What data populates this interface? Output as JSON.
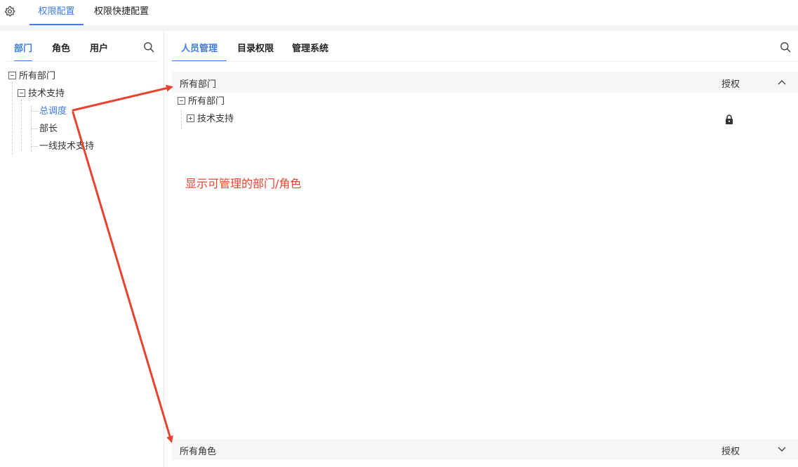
{
  "top_tabs": [
    {
      "label": "权限配置"
    },
    {
      "label": "权限快捷配置"
    }
  ],
  "left": {
    "tabs": [
      {
        "label": "部门"
      },
      {
        "label": "角色"
      },
      {
        "label": "用户"
      }
    ],
    "tree": {
      "root": "所有部门",
      "child": "技术支持",
      "leaves": [
        "总调度",
        "部长",
        "一线技术支持"
      ]
    }
  },
  "right": {
    "tabs": [
      {
        "label": "人员管理"
      },
      {
        "label": "目录权限"
      },
      {
        "label": "管理系统"
      }
    ],
    "section1": {
      "title": "所有部门",
      "auth": "授权",
      "tree_root": "所有部门",
      "tree_child": "技术支持"
    },
    "section2": {
      "title": "所有角色",
      "auth": "授权"
    }
  },
  "annotation": "显示可管理的部门/角色",
  "colors": {
    "accent": "#3e7ce8",
    "annotation": "#e8432e"
  },
  "icons": [
    "gear-icon",
    "search-icon",
    "lock-icon",
    "chevron-up-icon",
    "chevron-down-icon"
  ]
}
